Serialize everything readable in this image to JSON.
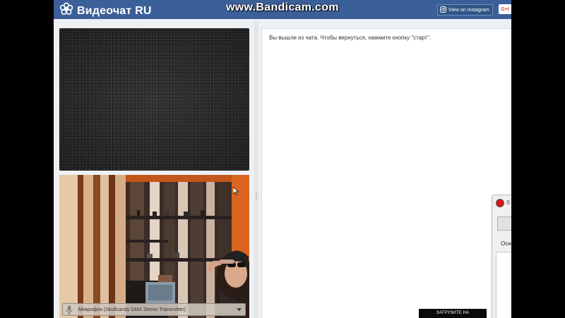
{
  "watermark": "www.Bandicam.com",
  "header": {
    "logo_text": "Видеочат RU",
    "instagram_label": "View on Instagram",
    "gplus_label": "G+I"
  },
  "chat": {
    "status_message": "Вы вышли из чата. Чтобы вернуться, нажмите кнопку \"старт\"."
  },
  "self_video": {
    "mic_label": "Микрофон (Skullcandy GMX Stereo Transmitter)"
  },
  "recorder": {
    "title": "B",
    "tab_label": "Осн"
  },
  "upload_badge": "ЗАГРУЗИТЕ НА",
  "colors": {
    "header": "#3b5f98",
    "page_bg": "#eef1f4",
    "record_red": "#dd1111"
  },
  "icons": [
    "logo-flower-icon",
    "instagram-icon",
    "microphone-icon",
    "chevron-down-icon",
    "record-icon",
    "cursor-icon"
  ]
}
